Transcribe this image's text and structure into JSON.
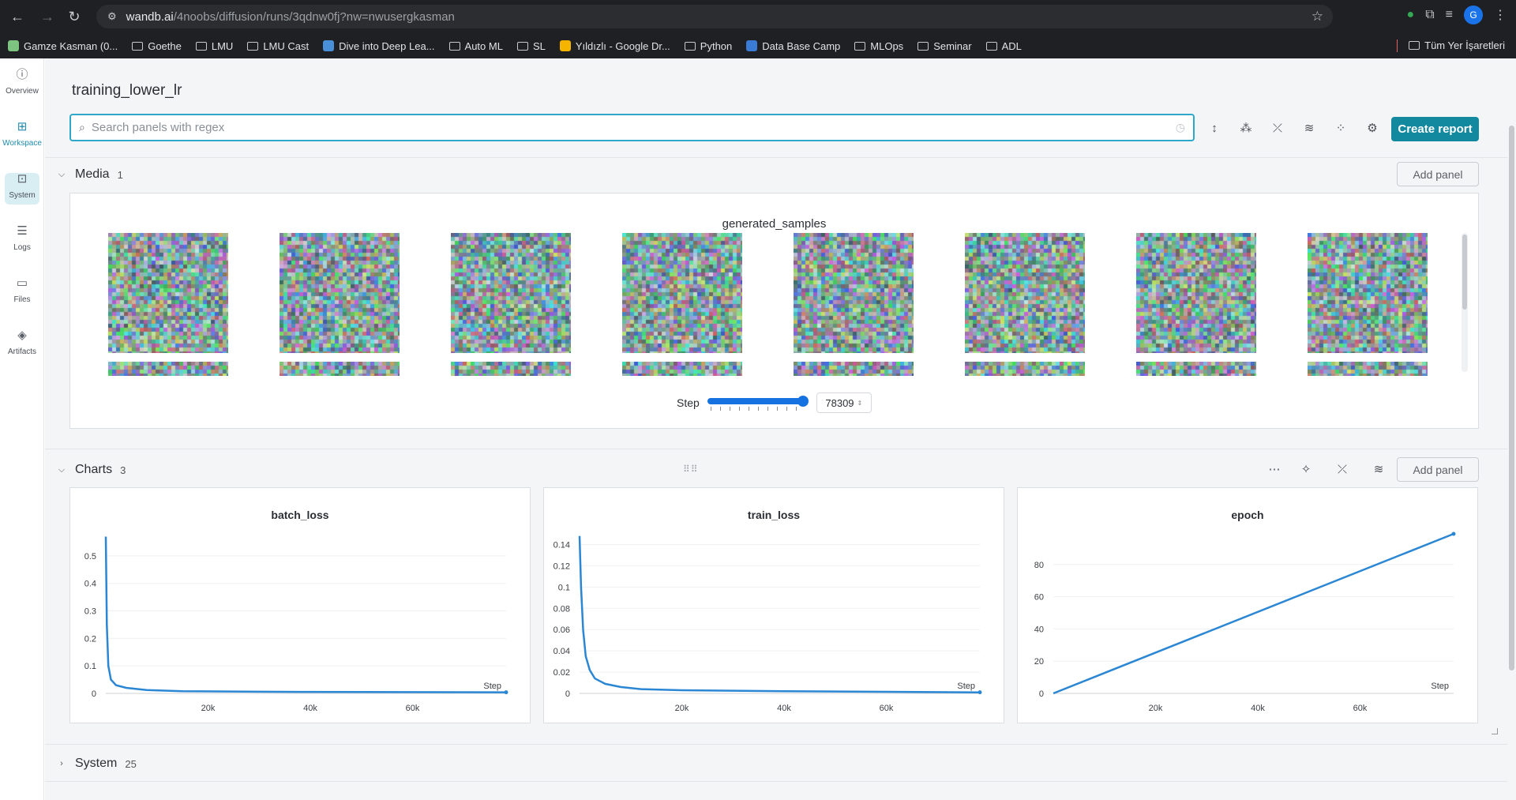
{
  "browser": {
    "url_host": "wandb.ai",
    "url_path": "/4noobs/diffusion/runs/3qdnw0fj?nw=nwusergkasman",
    "profile_initial": "G",
    "bookmarks": [
      "Gamze Kasman (0...",
      "Goethe",
      "LMU",
      "LMU Cast",
      "Dive into Deep Lea...",
      "Auto ML",
      "SL",
      "Yıldızlı - Google Dr...",
      "Python",
      "Data Base Camp",
      "MLOps",
      "Seminar",
      "ADL"
    ],
    "bookmarks_right": "Tüm Yer İşaretleri"
  },
  "rail": {
    "items": [
      {
        "label": "Overview",
        "icon": "info-icon"
      },
      {
        "label": "Workspace",
        "icon": "workspace-icon"
      },
      {
        "label": "System",
        "icon": "chip-icon"
      },
      {
        "label": "Logs",
        "icon": "list-icon"
      },
      {
        "label": "Files",
        "icon": "file-icon"
      },
      {
        "label": "Artifacts",
        "icon": "layers-icon"
      }
    ],
    "active": "Workspace"
  },
  "header": {
    "run_name": "training_lower_lr",
    "search_placeholder": "Search panels with regex",
    "create_report": "Create report"
  },
  "media": {
    "name": "Media",
    "count": "1",
    "add_panel": "Add panel",
    "panel_title": "generated_samples",
    "sample_count": 8,
    "step_label": "Step",
    "step_value": "78309"
  },
  "charts": {
    "name": "Charts",
    "count": "3",
    "add_panel": "Add panel",
    "step_axis_label": "Step"
  },
  "system": {
    "name": "System",
    "count": "25"
  },
  "chart_data": [
    {
      "type": "line",
      "title": "batch_loss",
      "xlabel": "Step",
      "xlim": [
        0,
        78309
      ],
      "ylim": [
        0,
        0.58
      ],
      "xticks": [
        "20k",
        "40k",
        "60k"
      ],
      "yticks": [
        "0",
        "0.1",
        "0.2",
        "0.3",
        "0.4",
        "0.5"
      ],
      "series": [
        {
          "x": [
            0,
            200,
            500,
            1000,
            2000,
            4000,
            8000,
            15000,
            30000,
            50000,
            78309
          ],
          "y": [
            0.57,
            0.25,
            0.1,
            0.05,
            0.03,
            0.02,
            0.012,
            0.008,
            0.006,
            0.005,
            0.004
          ]
        }
      ]
    },
    {
      "type": "line",
      "title": "train_loss",
      "xlabel": "Step",
      "xlim": [
        0,
        78309
      ],
      "ylim": [
        0,
        0.15
      ],
      "xticks": [
        "20k",
        "40k",
        "60k"
      ],
      "yticks": [
        "0",
        "0.02",
        "0.04",
        "0.06",
        "0.08",
        "0.1",
        "0.12",
        "0.14"
      ],
      "series": [
        {
          "x": [
            0,
            300,
            700,
            1200,
            2000,
            3000,
            5000,
            8000,
            12000,
            20000,
            40000,
            60000,
            78309
          ],
          "y": [
            0.148,
            0.1,
            0.06,
            0.035,
            0.022,
            0.014,
            0.009,
            0.006,
            0.004,
            0.003,
            0.002,
            0.0015,
            0.001
          ]
        }
      ]
    },
    {
      "type": "line",
      "title": "epoch",
      "xlabel": "Step",
      "xlim": [
        0,
        78309
      ],
      "ylim": [
        0,
        99
      ],
      "xticks": [
        "20k",
        "40k",
        "60k"
      ],
      "yticks": [
        "0",
        "20",
        "40",
        "60",
        "80"
      ],
      "series": [
        {
          "x": [
            0,
            78309
          ],
          "y": [
            0,
            99
          ]
        }
      ]
    }
  ]
}
